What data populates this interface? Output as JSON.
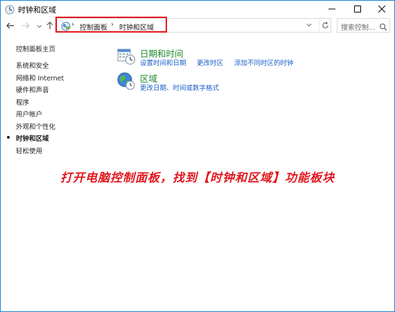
{
  "window": {
    "title": "时钟和区域",
    "buttons": {
      "minimize": "minimize",
      "maximize": "maximize",
      "close": "close"
    }
  },
  "navigation": {
    "back_icon": "arrow-left-icon",
    "forward_icon": "arrow-right-icon",
    "recent_icon": "chevron-down-icon",
    "up_icon": "arrow-up-icon"
  },
  "address": {
    "separator": "›",
    "crumbs": [
      "控制面板",
      "时钟和区域"
    ],
    "dropdown": "⌄",
    "refresh_icon": "refresh-icon"
  },
  "search": {
    "placeholder": "搜索控制..."
  },
  "sidebar": {
    "home": "控制面板主页",
    "items": [
      {
        "label": "系统和安全"
      },
      {
        "label": "网络和 Internet"
      },
      {
        "label": "硬件和声音"
      },
      {
        "label": "程序"
      },
      {
        "label": "用户帐户"
      },
      {
        "label": "外观和个性化"
      },
      {
        "label": "时钟和区域",
        "current": true
      },
      {
        "label": "轻松使用"
      }
    ]
  },
  "categories": [
    {
      "title": "日期和时间",
      "icon": "calendar-clock-icon",
      "links": [
        "设置时间和日期",
        "更改时区",
        "添加不同时区的时钟"
      ]
    },
    {
      "title": "区域",
      "icon": "globe-clock-icon",
      "links": [
        "更改日期、时间或数字格式"
      ]
    }
  ],
  "caption": "打开电脑控制面板，找到【时钟和区域】功能板块",
  "colors": {
    "highlight": "#e0181f",
    "category_title": "#1e8a2e",
    "link": "#1a5ec9",
    "window_border": "#1883d7"
  }
}
